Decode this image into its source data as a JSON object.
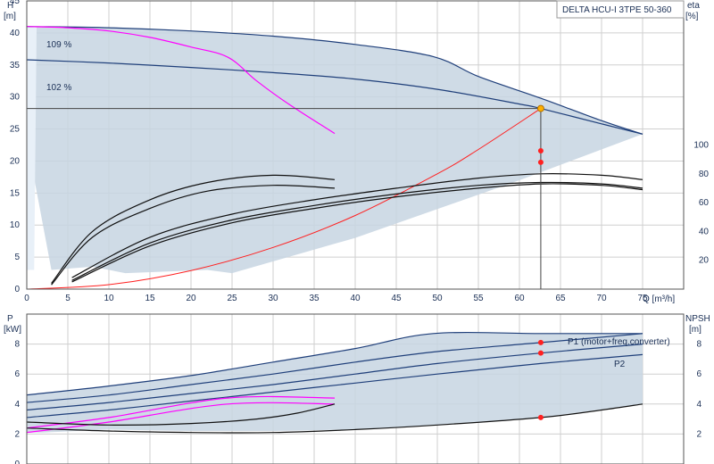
{
  "chart_data": [
    {
      "type": "line",
      "title": "DELTA HCU-I 3TPE 50-360",
      "xlabel": "Q [m³/h]",
      "ylabel": [
        "H",
        "[m]"
      ],
      "ylabel_right": [
        "eta",
        "[%]"
      ],
      "xlim": [
        0,
        80
      ],
      "ylim": [
        0,
        45
      ],
      "x_ticks": [
        0,
        5,
        10,
        15,
        20,
        25,
        30,
        35,
        40,
        45,
        50,
        55,
        60,
        65,
        70,
        75
      ],
      "y_ticks": [
        0,
        5,
        10,
        15,
        20,
        25,
        30,
        35,
        40,
        45
      ],
      "eta_ticks": [
        20,
        40,
        60,
        80,
        100
      ],
      "eta_range": [
        0,
        200
      ],
      "grid": true,
      "annotations": [
        {
          "text": "109 %",
          "x": 1.5,
          "y": 41.5
        },
        {
          "text": "102 %",
          "x": 1.5,
          "y": 36.2
        }
      ],
      "operating_point": {
        "x": 62.6,
        "y": 28.2,
        "eta": [
          96,
          88
        ]
      },
      "colors": {
        "line": "#1f3f7a",
        "magenta": "#ff00ff",
        "red": "#ff2020",
        "black": "#111111",
        "area": "#c7d5e2",
        "op": "#ffb000"
      },
      "series": [
        {
          "key": "h109",
          "color": "#1f3f7a",
          "x": [
            0,
            10,
            20,
            30,
            40,
            49.5,
            55,
            62.6,
            70,
            75
          ],
          "y": [
            41,
            40.8,
            40.3,
            39.5,
            38.2,
            36.3,
            33.2,
            29.8,
            26.3,
            24.2
          ]
        },
        {
          "key": "h102",
          "color": "#1f3f7a",
          "x": [
            0,
            10,
            20,
            30,
            40,
            50,
            60,
            62.6,
            70,
            75
          ],
          "y": [
            35.8,
            35.3,
            34.6,
            33.8,
            32.8,
            31.2,
            28.9,
            28.2,
            25.8,
            24.2
          ]
        },
        {
          "key": "hmag",
          "color": "#ff00ff",
          "x": [
            0,
            5,
            10,
            15,
            20,
            24.5,
            28,
            32,
            37.5
          ],
          "y": [
            41,
            40.8,
            40.3,
            39.3,
            37.8,
            36.2,
            32.5,
            28.8,
            24.3
          ]
        },
        {
          "key": "system",
          "color": "#ff2020",
          "x": [
            0,
            10,
            20,
            30,
            40,
            50,
            55,
            62.6
          ],
          "y": [
            0,
            0.7,
            2.9,
            6.5,
            11.5,
            18,
            21.8,
            28.2
          ]
        },
        {
          "key": "eta1",
          "color": "#111111",
          "eta": true,
          "x": [
            3,
            8,
            15,
            22,
            30,
            37.5
          ],
          "y": [
            4,
            40,
            62,
            74,
            79,
            76
          ]
        },
        {
          "key": "eta2",
          "color": "#111111",
          "eta": true,
          "x": [
            3,
            8,
            15,
            22,
            30,
            37.5
          ],
          "y": [
            3,
            36,
            56,
            68,
            72,
            70
          ]
        },
        {
          "key": "eta3",
          "color": "#111111",
          "eta": true,
          "x": [
            5.5,
            15,
            25,
            35,
            45,
            55,
            62.6,
            70,
            75
          ],
          "y": [
            8,
            36,
            52,
            62,
            70,
            77,
            80,
            79,
            76
          ]
        },
        {
          "key": "eta4",
          "color": "#111111",
          "eta": true,
          "x": [
            5.5,
            15,
            25,
            35,
            45,
            55,
            62.6,
            70,
            75
          ],
          "y": [
            6,
            32,
            48,
            58,
            66,
            72,
            74,
            73,
            70
          ]
        },
        {
          "key": "eta5",
          "color": "#111111",
          "eta": true,
          "x": [
            5.5,
            15,
            25,
            35,
            45,
            55,
            62.6,
            70,
            75
          ],
          "y": [
            5,
            30,
            46,
            56,
            64,
            70,
            73,
            72,
            69
          ]
        }
      ]
    },
    {
      "type": "line",
      "ylabel": [
        "P",
        "[kW]"
      ],
      "ylabel_right": [
        "NPSH",
        "[m]"
      ],
      "xlim": [
        0,
        80
      ],
      "ylim": [
        0,
        10
      ],
      "y_ticks": [
        0,
        2,
        4,
        6,
        8
      ],
      "npsh_ticks": [
        2,
        4,
        6,
        8
      ],
      "grid": true,
      "legend": [
        "P1 (motor+freq.converter)",
        "P2"
      ],
      "operating_point": {
        "x": 62.6,
        "p1": 8.1,
        "p2": 7.4,
        "npsh": 3.1
      },
      "series": [
        {
          "key": "p1_outer",
          "color": "#1f3f7a",
          "x": [
            0,
            10,
            20,
            30,
            40,
            49.5,
            62.6,
            75
          ],
          "y": [
            4.6,
            5.2,
            5.9,
            6.8,
            7.7,
            8.7,
            8.7,
            8.7
          ]
        },
        {
          "key": "p1",
          "color": "#1f3f7a",
          "x": [
            0,
            10,
            20,
            30,
            40,
            50,
            62.6,
            75
          ],
          "y": [
            4.1,
            4.6,
            5.3,
            6.0,
            6.8,
            7.5,
            8.1,
            8.7
          ]
        },
        {
          "key": "p2",
          "color": "#1f3f7a",
          "x": [
            0,
            10,
            20,
            30,
            40,
            50,
            62.6,
            75
          ],
          "y": [
            3.6,
            4.1,
            4.7,
            5.3,
            6.0,
            6.7,
            7.4,
            8.0
          ]
        },
        {
          "key": "p_low",
          "color": "#1f3f7a",
          "x": [
            0,
            10,
            20,
            30,
            40,
            50,
            62.6,
            75
          ],
          "y": [
            3.1,
            3.6,
            4.2,
            4.8,
            5.4,
            6.0,
            6.7,
            7.3
          ]
        },
        {
          "key": "p1_mag",
          "color": "#ff00ff",
          "x": [
            0,
            10,
            24.5,
            37.5
          ],
          "y": [
            2.4,
            3.1,
            4.4,
            4.4
          ]
        },
        {
          "key": "p2_mag",
          "color": "#ff00ff",
          "x": [
            0,
            10,
            24.5,
            37.5
          ],
          "y": [
            2.1,
            2.8,
            4.0,
            4.0
          ]
        },
        {
          "key": "npsh_b",
          "color": "#111111",
          "x": [
            0,
            10,
            20,
            28,
            33,
            37.5
          ],
          "y": [
            2.8,
            2.6,
            2.7,
            3.0,
            3.4,
            4.0
          ]
        },
        {
          "key": "npsh",
          "color": "#111111",
          "x": [
            0,
            10,
            20,
            30,
            40,
            50,
            62.6,
            70,
            75
          ],
          "y": [
            2.4,
            2.2,
            2.1,
            2.1,
            2.3,
            2.6,
            3.1,
            3.6,
            4.0
          ]
        }
      ]
    }
  ]
}
